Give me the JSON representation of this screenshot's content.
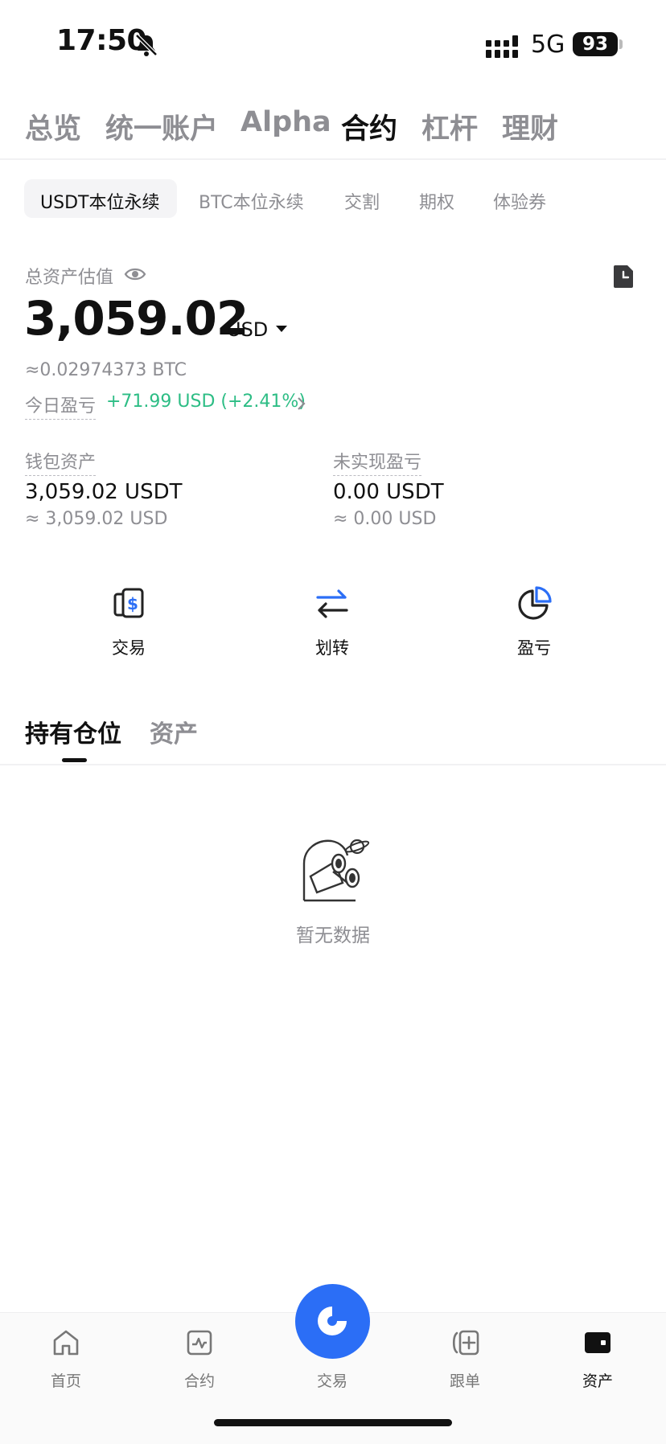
{
  "status_bar": {
    "time": "17:50",
    "network": "5G",
    "battery": "93"
  },
  "top_tabs": [
    "总览",
    "统一账户",
    "Alpha",
    "合约",
    "杠杆",
    "理财"
  ],
  "sub_tabs": [
    "USDT本位永续",
    "BTC本位永续",
    "交割",
    "期权",
    "体验券"
  ],
  "assets": {
    "total_label": "总资产估值",
    "total_value": "3,059.02",
    "currency": "USD",
    "btc_equiv": "≈0.02974373 BTC",
    "today_pnl_label": "今日盈亏",
    "today_pnl_value": "+71.99 USD (+2.41%)"
  },
  "wallet": {
    "label": "钱包资产",
    "value": "3,059.02 USDT",
    "usd": "≈ 3,059.02 USD"
  },
  "unrealized": {
    "label": "未实现盈亏",
    "value": "0.00 USDT",
    "usd": "≈ 0.00 USD"
  },
  "actions": [
    "交易",
    "划转",
    "盈亏"
  ],
  "position_tabs": [
    "持有仓位",
    "资产"
  ],
  "empty_text": "暂无数据",
  "bottom_nav": [
    "首页",
    "合约",
    "交易",
    "跟单",
    "资产"
  ],
  "colors": {
    "accent": "#2b6ef6",
    "profit": "#2dbd85"
  }
}
